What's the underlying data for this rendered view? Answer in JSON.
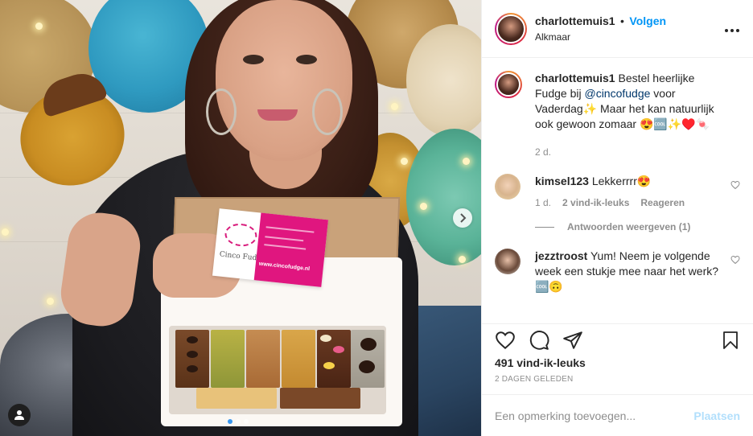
{
  "post": {
    "username": "charlottemuis1",
    "separator": "•",
    "follow_label": "Volgen",
    "location": "Alkmaar",
    "more_label": "•••"
  },
  "caption": {
    "username": "charlottemuis1",
    "text_part1": " Bestel heerlijke Fudge bij ",
    "mention": "@cincofudge",
    "text_part2": " voor Vaderdag✨ Maar het kan natuurlijk ook gewoon zomaar 😍🆒✨♥️🍬",
    "age": "2 d."
  },
  "comments": [
    {
      "username": "kimsel123",
      "text": " Lekkerrrr😍",
      "age": "1 d.",
      "likes": "2 vind-ik-leuks",
      "reply_label": "Reageren",
      "view_replies": "Antwoorden weergeven (1)"
    },
    {
      "username": "jezztroost",
      "text": " Yum! Neem je volgende week een stukje mee naar het werk? 🆒🙃"
    }
  ],
  "engagement": {
    "likes": "491 vind-ik-leuks",
    "date": "2 DAGEN GELEDEN"
  },
  "comment_box": {
    "placeholder": "Een opmerking toevoegen...",
    "post_label": "Plaatsen"
  },
  "photo_card": {
    "brand": "Cinco Fudge",
    "url": "www.cincofudge.nl"
  },
  "carousel": {
    "slide_count": 3,
    "active_index": 0
  },
  "colors": {
    "accent": "#0095f6",
    "card_pink": "#e0167f"
  }
}
